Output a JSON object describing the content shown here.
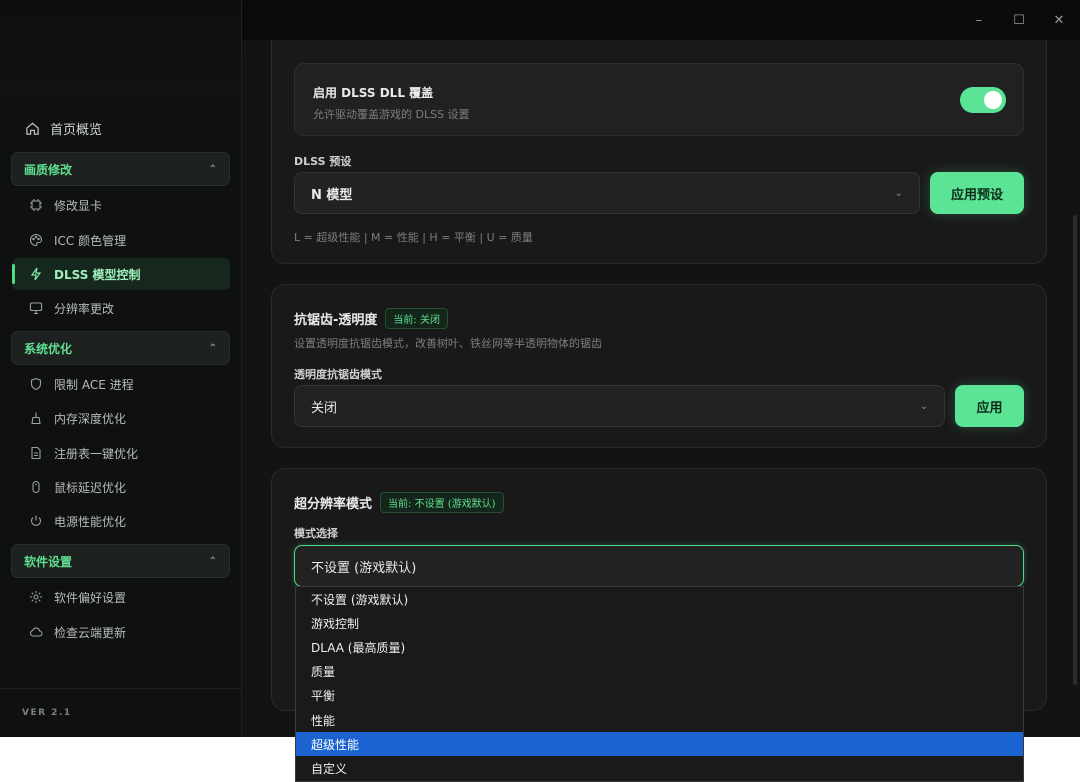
{
  "window": {
    "minimize": "–",
    "maximize": "☐",
    "close": "✕"
  },
  "sidebar": {
    "home": "首页概览",
    "groups": [
      {
        "label": "画质修改",
        "items": [
          "修改显卡",
          "ICC 颜色管理",
          "DLSS 模型控制",
          "分辨率更改"
        ]
      },
      {
        "label": "系统优化",
        "items": [
          "限制 ACE 进程",
          "内存深度优化",
          "注册表一键优化",
          "鼠标延迟优化",
          "电源性能优化"
        ]
      },
      {
        "label": "软件设置",
        "items": [
          "软件偏好设置",
          "检查云端更新"
        ]
      }
    ],
    "active_item": "DLSS 模型控制",
    "version": "VER 2.1"
  },
  "dlss_card": {
    "toggle_title": "启用 DLSS DLL 覆盖",
    "toggle_desc": "允许驱动覆盖游戏的 DLSS 设置",
    "toggle_on": true,
    "preset_label": "DLSS 预设",
    "preset_value": "N 模型",
    "apply_label": "应用预设",
    "legend": "L = 超级性能 | M = 性能 | H = 平衡 | U = 质量"
  },
  "aa_card": {
    "title": "抗锯齿-透明度",
    "badge": "当前: 关闭",
    "desc": "设置透明度抗锯齿模式，改善树叶、铁丝网等半透明物体的锯齿",
    "field_label": "透明度抗锯齿模式",
    "value": "关闭",
    "apply_label": "应用"
  },
  "sr_card": {
    "title": "超分辨率模式",
    "badge": "当前: 不设置 (游戏默认)",
    "field_label": "模式选择",
    "value": "不设置 (游戏默认)",
    "options": [
      "不设置 (游戏默认)",
      "游戏控制",
      "DLAA (最高质量)",
      "质量",
      "平衡",
      "性能",
      "超级性能",
      "自定义"
    ],
    "highlighted": "超级性能"
  },
  "colors": {
    "accent": "#5be495",
    "highlight": "#1a63d1",
    "background": "#131313"
  }
}
